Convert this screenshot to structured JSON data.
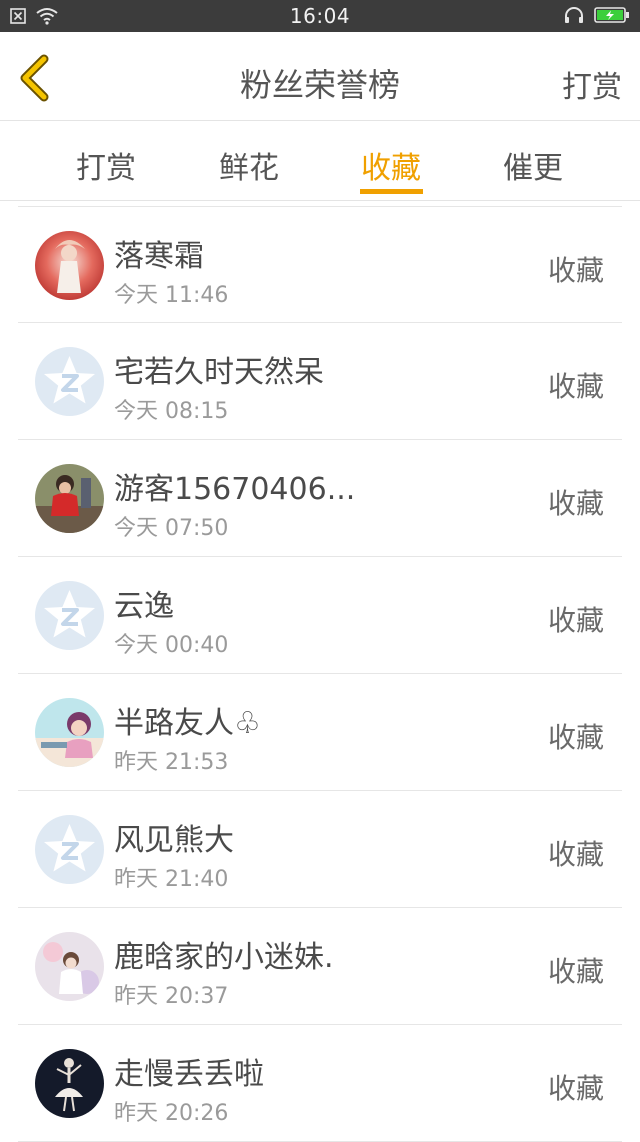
{
  "status_bar": {
    "time": "16:04",
    "icons": [
      "close-box-icon",
      "wifi-icon",
      "headphones-icon",
      "battery-charging-icon"
    ]
  },
  "header": {
    "title": "粉丝荣誉榜",
    "action_label": "打赏",
    "back_icon": "chevron-left-icon",
    "accent_color": "#f0c000"
  },
  "tabs": [
    {
      "label": "打赏",
      "active": false
    },
    {
      "label": "鲜花",
      "active": false
    },
    {
      "label": "收藏",
      "active": true
    },
    {
      "label": "催更",
      "active": false
    }
  ],
  "active_tab_color": "#f0a000",
  "list": {
    "items": [
      {
        "name": "落寒霜",
        "time": "今天 11:46",
        "action": "收藏",
        "avatar": "photo-red"
      },
      {
        "name": "宅若久时天然呆",
        "time": "今天 08:15",
        "action": "收藏",
        "avatar": "default-star"
      },
      {
        "name": "游客15670406...",
        "time": "今天 07:50",
        "action": "收藏",
        "avatar": "photo-child"
      },
      {
        "name": "云逸",
        "time": "今天 00:40",
        "action": "收藏",
        "avatar": "default-star"
      },
      {
        "name": "半路友人♧",
        "time": "昨天 21:53",
        "action": "收藏",
        "avatar": "photo-girl"
      },
      {
        "name": "风见熊大",
        "time": "昨天 21:40",
        "action": "收藏",
        "avatar": "default-star"
      },
      {
        "name": "鹿晗家的小迷妹.",
        "time": "昨天 20:37",
        "action": "收藏",
        "avatar": "photo-pastel"
      },
      {
        "name": "走慢丢丢啦",
        "time": "昨天 20:26",
        "action": "收藏",
        "avatar": "photo-dancer"
      }
    ]
  }
}
